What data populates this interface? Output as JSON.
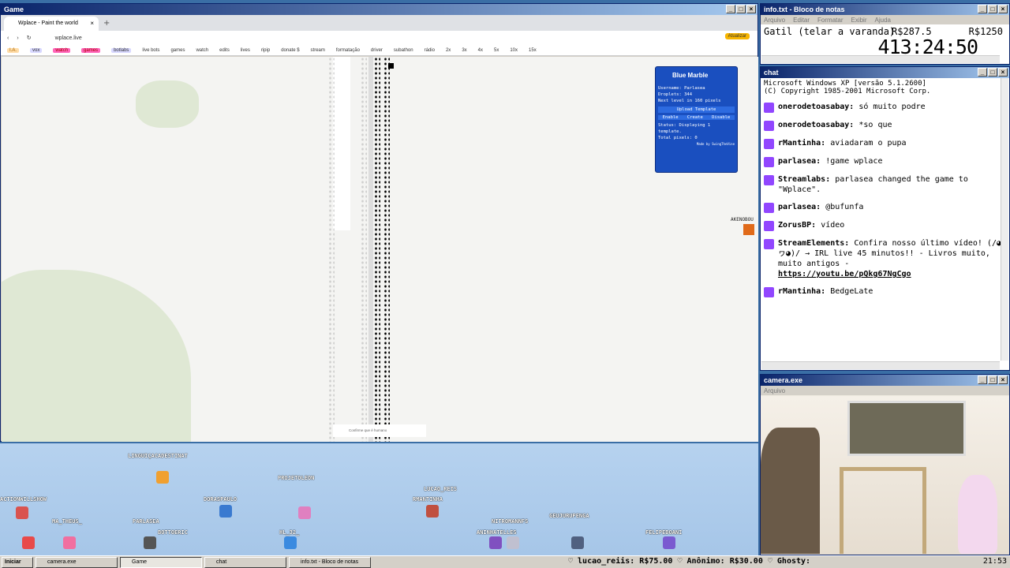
{
  "game_window": {
    "title": "Game",
    "tab_title": "Wplace - Paint the world",
    "url": "wplace.live",
    "update_label": "Atualizar",
    "bookmarks": [
      "I.A.",
      "vox",
      "watch",
      "games",
      "botlabs",
      "live bots",
      "games",
      "watch",
      "edits",
      "lives",
      "ripip",
      "donate $",
      "stream",
      "formatação",
      "driver",
      "subathon",
      "rádio",
      "2x",
      "3x",
      "4x",
      "5x",
      "10x",
      "15x"
    ],
    "captcha_text": "Confirme que é humano",
    "avatar_top_name": "AKENOBOU"
  },
  "blue_marble": {
    "title": "Blue Marble",
    "username": "Username: Parlasea",
    "droplets": "Droplets: 344",
    "next_level": "Next level in 160 pixels",
    "upload_label": "Upload Template",
    "enable": "Enable",
    "create": "Create",
    "disable": "Disable",
    "status": "Status: Displaying 1 template.",
    "total": "Total pixels: 0",
    "made_by": "Made by SwingTheVine"
  },
  "notepad": {
    "title": "info.txt - Bloco de notas",
    "menu": [
      "Arquivo",
      "Editar",
      "Formatar",
      "Exibir",
      "Ajuda"
    ],
    "line_left": "Gatil (telar a varanda)",
    "line_amount": "R$287.5",
    "line_right": "R$1250",
    "timer": "413:24:50"
  },
  "chat": {
    "title": "chat",
    "header_line1": "Microsoft Windows XP [versão 5.1.2600]",
    "header_line2": "(C) Copyright 1985-2001 Microsoft Corp.",
    "messages": [
      {
        "user": "onerodetoasabay:",
        "text": "só muito podre"
      },
      {
        "user": "onerodetoasabay:",
        "text": "*so que"
      },
      {
        "user": "rMantinha:",
        "text": "aviadaram o pupa"
      },
      {
        "user": "parlasea:",
        "text": "!game wplace"
      },
      {
        "user": "Streamlabs:",
        "text": "parlasea changed the game to \"Wplace\"."
      },
      {
        "user": "parlasea:",
        "text": "@bufunfa"
      },
      {
        "user": "ZorusBP:",
        "text": "vídeo"
      },
      {
        "user": "StreamElements:",
        "text": "Confira nosso último vídeo! (/◕ヮ◕)/ → IRL live 45 minutos!! - Livros muito, muito antigos -"
      },
      {
        "user": "rMantinha:",
        "text": "BedgeLate"
      }
    ],
    "link": "https://youtu.be/pQkg67NgCgo"
  },
  "camera": {
    "title": "camera.exe",
    "menu": "Arquivo"
  },
  "overlay": {
    "names": [
      "LINGUIÇACADESTINAT",
      "PROJETOLEON",
      "LUCAO_REIS",
      "RMANTINHA",
      "ACTIONWILLSHOW",
      "MA_THEUS_",
      "PARLASEA",
      "DORASPAULO",
      "HL_32_",
      "BOTTOERIC",
      "NITROMANNFS",
      "ANINHATELLES",
      "GEUJURUPENGA",
      "FELIPEBOANI"
    ]
  },
  "taskbar": {
    "start": "Iniciar",
    "tasks": [
      "camera.exe",
      "Game",
      "chat",
      "info.txt - Bloco de notas"
    ],
    "ticker": "♡ lucao_reiis: R$75.00   ♡ Anônimo: R$30.00   ♡ Ghosty:",
    "clock": "21:53"
  }
}
